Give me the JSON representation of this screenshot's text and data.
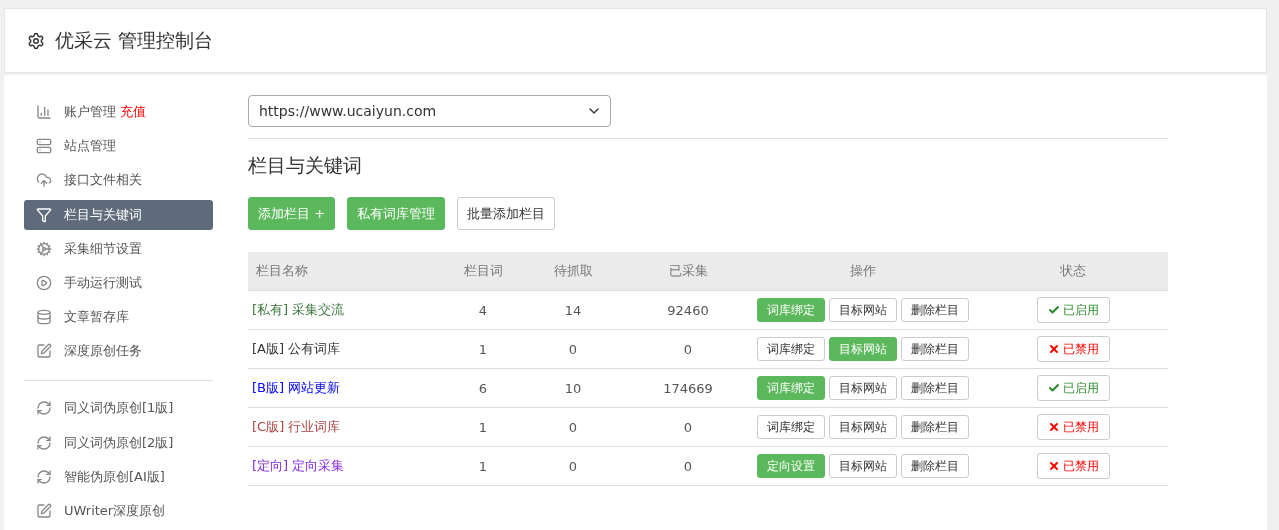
{
  "header": {
    "title": "优采云 管理控制台"
  },
  "sidebar": {
    "sections": [
      {
        "items": [
          {
            "label": "账户管理",
            "badge": "充值",
            "selected": false
          },
          {
            "label": "站点管理",
            "selected": false
          },
          {
            "label": "接口文件相关",
            "selected": false
          },
          {
            "label": "栏目与关键词",
            "selected": true
          },
          {
            "label": "采集细节设置",
            "selected": false
          },
          {
            "label": "手动运行测试",
            "selected": false
          },
          {
            "label": "文章暂存库",
            "selected": false
          },
          {
            "label": "深度原创任务",
            "selected": false
          }
        ]
      },
      {
        "items": [
          {
            "label": "同义词伪原创[1版]",
            "selected": false
          },
          {
            "label": "同义词伪原创[2版]",
            "selected": false
          },
          {
            "label": "智能伪原创[AI版]",
            "selected": false
          },
          {
            "label": "UWriter深度原创",
            "selected": false
          }
        ]
      }
    ]
  },
  "site_select": {
    "value": "https://www.ucaiyun.com"
  },
  "section_title": "栏目与关键词",
  "toolbar": [
    {
      "label": "添加栏目 +",
      "kind": "primary"
    },
    {
      "label": "私有词库管理",
      "kind": "primary"
    },
    {
      "label": "批量添加栏目",
      "kind": "default"
    }
  ],
  "table": {
    "columns": [
      "栏目名称",
      "栏目词",
      "待抓取",
      "已采集",
      "操作",
      "状态"
    ],
    "rows": [
      {
        "tag": "[私有]",
        "name": "采集交流",
        "color": "#3c763d",
        "c2": "4",
        "c3": "14",
        "c4": "92460",
        "actions": [
          {
            "label": "词库绑定",
            "kind": "primary"
          },
          {
            "label": "目标网站",
            "kind": "default"
          },
          {
            "label": "删除栏目",
            "kind": "default"
          }
        ],
        "status": "已启用",
        "enabled": true
      },
      {
        "tag": "[A版]",
        "name": "公有词库",
        "color": "#333333",
        "c2": "1",
        "c3": "0",
        "c4": "0",
        "actions": [
          {
            "label": "词库绑定",
            "kind": "default"
          },
          {
            "label": "目标网站",
            "kind": "primary"
          },
          {
            "label": "删除栏目",
            "kind": "default"
          }
        ],
        "status": "已禁用",
        "enabled": false
      },
      {
        "tag": "[B版]",
        "name": "网站更新",
        "color": "#0000ff",
        "c2": "6",
        "c3": "10",
        "c4": "174669",
        "actions": [
          {
            "label": "词库绑定",
            "kind": "primary"
          },
          {
            "label": "目标网站",
            "kind": "default"
          },
          {
            "label": "删除栏目",
            "kind": "default"
          }
        ],
        "status": "已启用",
        "enabled": true
      },
      {
        "tag": "[C版]",
        "name": "行业词库",
        "color": "#a94442",
        "c2": "1",
        "c3": "0",
        "c4": "0",
        "actions": [
          {
            "label": "词库绑定",
            "kind": "default"
          },
          {
            "label": "目标网站",
            "kind": "default"
          },
          {
            "label": "删除栏目",
            "kind": "default"
          }
        ],
        "status": "已禁用",
        "enabled": false
      },
      {
        "tag": "[定向]",
        "name": "定向采集",
        "color": "#8a2be2",
        "c2": "1",
        "c3": "0",
        "c4": "0",
        "actions": [
          {
            "label": "定向设置",
            "kind": "primary"
          },
          {
            "label": "目标网站",
            "kind": "default"
          },
          {
            "label": "删除栏目",
            "kind": "default"
          }
        ],
        "status": "已禁用",
        "enabled": false
      }
    ]
  }
}
